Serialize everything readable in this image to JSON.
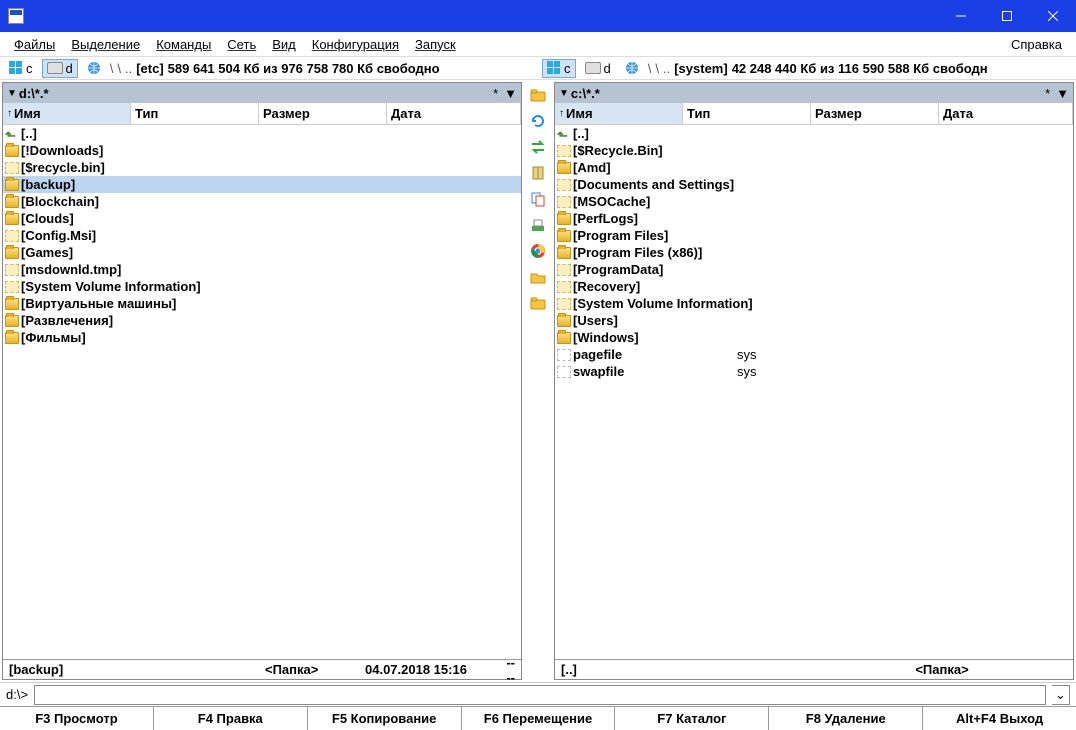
{
  "title": "",
  "menu": {
    "files": "Файлы",
    "selection": "Выделение",
    "commands": "Команды",
    "net": "Сеть",
    "view": "Вид",
    "config": "Конфигурация",
    "run": "Запуск",
    "help": "Справка"
  },
  "driveLeft": {
    "c": "c",
    "d": "d",
    "slash1": "\\",
    "slash2": "\\",
    "dots": "..",
    "bracket": "[etc]",
    "free": "589 641 504 Кб из 976 758 780 Кб свободно"
  },
  "driveRight": {
    "c": "c",
    "d": "d",
    "slash1": "\\",
    "slash2": "\\",
    "dots": "..",
    "bracket": "[system]",
    "free": "42 248 440 Кб из 116 590 588 Кб свободн"
  },
  "leftPanel": {
    "path": "d:\\*.*",
    "star": "*",
    "headers": {
      "name": "Имя",
      "type": "Тип",
      "size": "Размер",
      "date": "Дата"
    },
    "rows": [
      {
        "icon": "up",
        "name": "[..]"
      },
      {
        "icon": "folder",
        "name": "[!Downloads]"
      },
      {
        "icon": "hidden",
        "name": "[$recycle.bin]"
      },
      {
        "icon": "folder",
        "name": "[backup]",
        "selected": true
      },
      {
        "icon": "folder",
        "name": "[Blockchain]"
      },
      {
        "icon": "folder",
        "name": "[Clouds]"
      },
      {
        "icon": "hidden",
        "name": "[Config.Msi]"
      },
      {
        "icon": "folder",
        "name": "[Games]"
      },
      {
        "icon": "hidden",
        "name": "[msdownld.tmp]"
      },
      {
        "icon": "hidden",
        "name": "[System Volume Information]"
      },
      {
        "icon": "folder",
        "name": "[Виртуальные машины]"
      },
      {
        "icon": "folder",
        "name": "[Развлечения]"
      },
      {
        "icon": "folder",
        "name": "[Фильмы]"
      }
    ],
    "status": {
      "name": "[backup]",
      "size": "<Папка>",
      "date": "04.07.2018 15:16",
      "attr": "----"
    }
  },
  "rightPanel": {
    "path": "c:\\*.*",
    "star": "*",
    "headers": {
      "name": "Имя",
      "type": "Тип",
      "size": "Размер",
      "date": "Дата"
    },
    "rows": [
      {
        "icon": "up",
        "name": "[..]"
      },
      {
        "icon": "hidden",
        "name": "[$Recycle.Bin]"
      },
      {
        "icon": "folder",
        "name": "[Amd]"
      },
      {
        "icon": "hidden",
        "name": "[Documents and Settings]"
      },
      {
        "icon": "hidden",
        "name": "[MSOCache]"
      },
      {
        "icon": "folder",
        "name": "[PerfLogs]"
      },
      {
        "icon": "folder",
        "name": "[Program Files]"
      },
      {
        "icon": "folder",
        "name": "[Program Files (x86)]"
      },
      {
        "icon": "hidden",
        "name": "[ProgramData]"
      },
      {
        "icon": "hidden",
        "name": "[Recovery]"
      },
      {
        "icon": "hidden",
        "name": "[System Volume Information]"
      },
      {
        "icon": "folder",
        "name": "[Users]"
      },
      {
        "icon": "folder",
        "name": "[Windows]"
      },
      {
        "icon": "filehidden",
        "name": "pagefile",
        "type": "sys"
      },
      {
        "icon": "filehidden",
        "name": "swapfile",
        "type": "sys"
      }
    ],
    "status": {
      "name": "[..]",
      "size": "<Папка>",
      "date": "",
      "attr": ""
    }
  },
  "cmd": {
    "prompt": "d:\\>"
  },
  "fkeys": {
    "f3": "F3 Просмотр",
    "f4": "F4 Правка",
    "f5": "F5 Копирование",
    "f6": "F6 Перемещение",
    "f7": "F7 Каталог",
    "f8": "F8 Удаление",
    "altf4": "Alt+F4 Выход"
  }
}
